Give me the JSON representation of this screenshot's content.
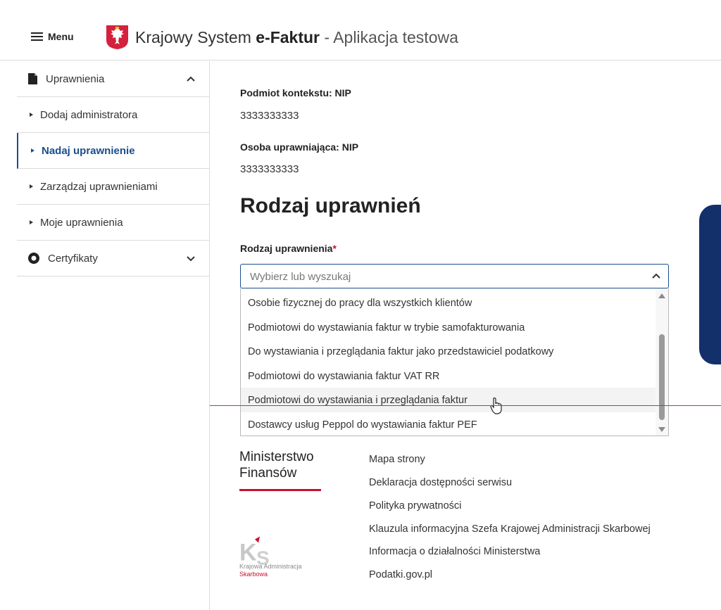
{
  "header": {
    "menu_label": "Menu",
    "brand_part1": "Krajowy System ",
    "brand_part2": "e-Faktur",
    "brand_part3": " - Aplikacja testowa"
  },
  "sidebar": {
    "section_permissions": "Uprawnienia",
    "items": [
      {
        "label": "Dodaj administratora"
      },
      {
        "label": "Nadaj uprawnienie"
      },
      {
        "label": "Zarządzaj uprawnieniami"
      },
      {
        "label": "Moje uprawnienia"
      }
    ],
    "section_certificates": "Certyfikaty"
  },
  "main": {
    "context_label": "Podmiot kontekstu: NIP",
    "context_value": "3333333333",
    "granting_label": "Osoba uprawniająca: NIP",
    "granting_value": "3333333333",
    "section_title": "Rodzaj uprawnień",
    "field_label": "Rodzaj uprawnienia",
    "required_mark": "*",
    "placeholder": "Wybierz lub wyszukaj",
    "options": [
      "Osobie fizycznej do pracy dla wszystkich klientów",
      "Podmiotowi do wystawiania faktur w trybie samofakturowania",
      "Do wystawiania i przeglądania faktur jako przedstawiciel podatkowy",
      "Podmiotowi do wystawiania faktur VAT RR",
      "Podmiotowi do wystawiania i przeglądania faktur",
      "Dostawcy usług Peppol do wystawiania faktur PEF"
    ]
  },
  "footer": {
    "mf_line1": "Ministerstwo",
    "mf_line2": "Finansów",
    "kas_line1": "Krajowa Administracja",
    "kas_line2": "Skarbowa",
    "links": [
      "Mapa strony",
      "Deklaracja dostępności serwisu",
      "Polityka prywatności",
      "Klauzula informacyjna Szefa Krajowej Administracji Skarbowej",
      "Informacja o działalności Ministerstwa",
      "Podatki.gov.pl"
    ]
  },
  "colors": {
    "accent": "#1a4e8c",
    "brand_red": "#c8102e",
    "side_panel": "#13306b"
  }
}
